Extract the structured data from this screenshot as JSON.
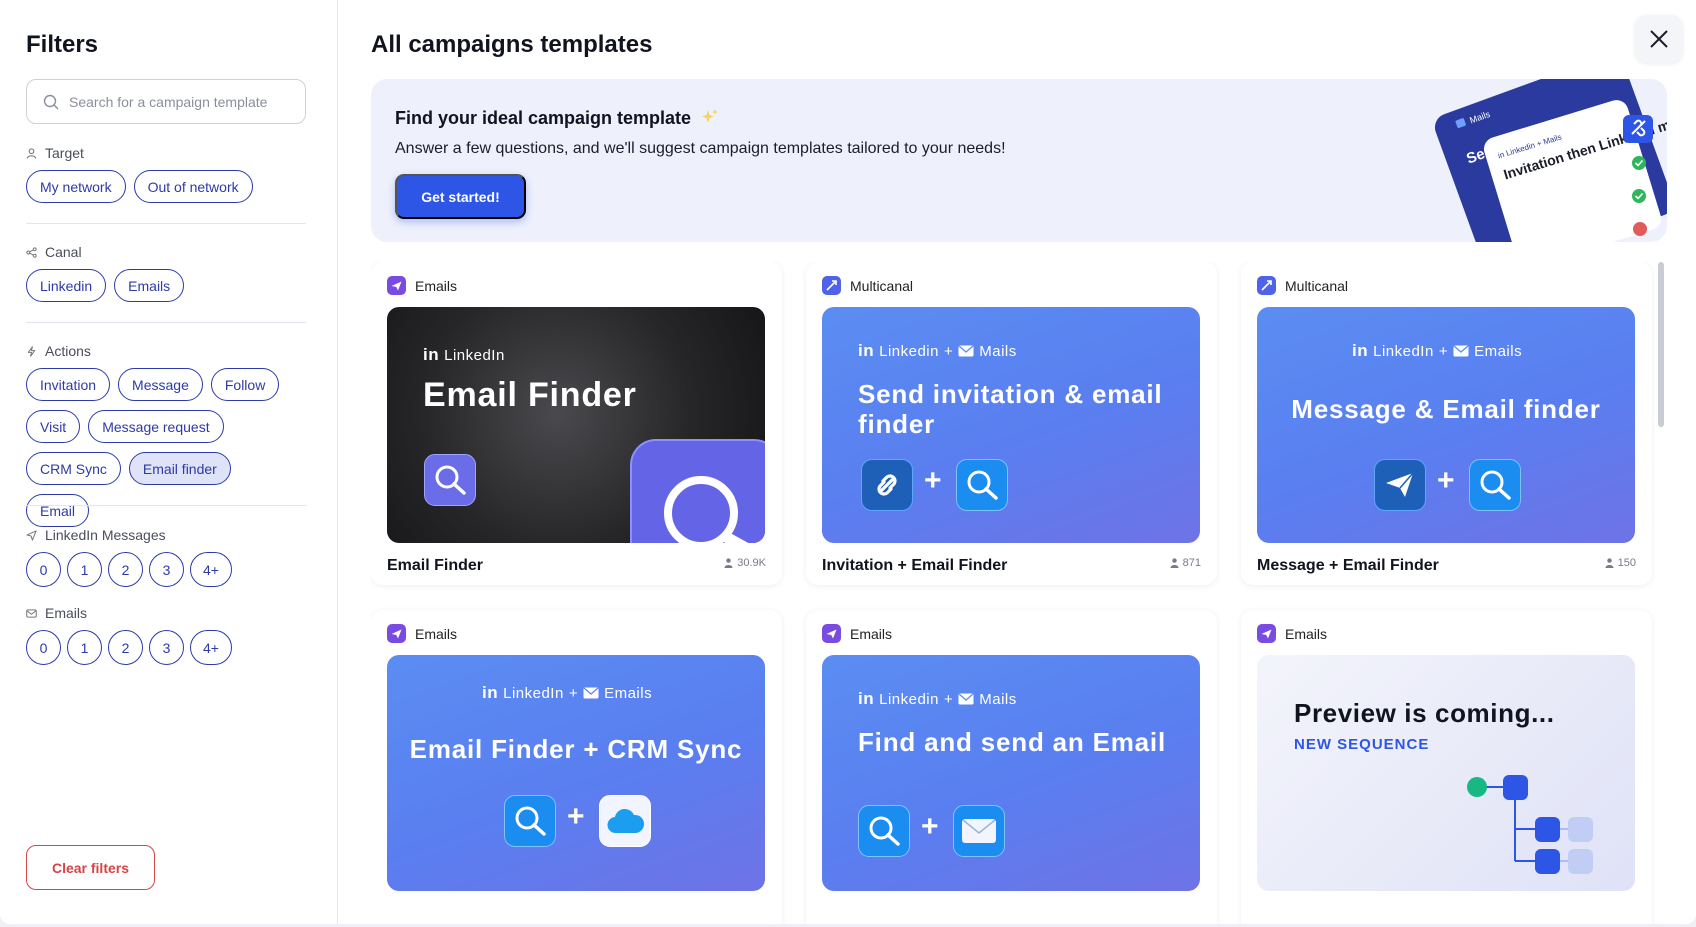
{
  "filters": {
    "title": "Filters",
    "search_placeholder": "Search for a campaign template",
    "target": {
      "label": "Target",
      "options": [
        "My network",
        "Out of network"
      ]
    },
    "canal": {
      "label": "Canal",
      "options": [
        "Linkedin",
        "Emails"
      ]
    },
    "actions": {
      "label": "Actions",
      "options": [
        "Invitation",
        "Message",
        "Follow",
        "Visit",
        "Message request",
        "CRM Sync",
        "Email finder",
        "Email"
      ],
      "selected": "Email finder"
    },
    "linkedin_messages": {
      "label": "LinkedIn Messages",
      "options": [
        "0",
        "1",
        "2",
        "3",
        "4+"
      ]
    },
    "emails": {
      "label": "Emails",
      "options": [
        "0",
        "1",
        "2",
        "3",
        "4+"
      ]
    },
    "clear_label": "Clear filters"
  },
  "main": {
    "title": "All campaigns templates",
    "banner": {
      "title": "Find your ideal campaign template",
      "subtitle": "Answer a few questions, and we'll suggest campaign templates tailored to your needs!",
      "button": "Get started!",
      "art": {
        "tag": "Mails",
        "front_header": "in Linkedin + Mails",
        "front_text": "Invitation then Linkedin messages or emails",
        "back_text": "Se... en..."
      }
    },
    "cards": [
      {
        "category": "Emails",
        "name": "Email Finder",
        "count": "30.9K",
        "thumb": {
          "top": "LinkedIn",
          "title": "Email Finder"
        }
      },
      {
        "category": "Multicanal",
        "name": "Invitation + Email Finder",
        "count": "871",
        "thumb": {
          "top_a": "Linkedin",
          "top_sep": "+",
          "top_b": "Mails",
          "title": "Send invitation & email finder"
        }
      },
      {
        "category": "Multicanal",
        "name": "Message + Email Finder",
        "count": "150",
        "thumb": {
          "top_a": "LinkedIn",
          "top_sep": "+",
          "top_b": "Emails",
          "title": "Message & Email finder"
        }
      },
      {
        "category": "Emails",
        "name": "",
        "thumb": {
          "top_a": "LinkedIn",
          "top_sep": "+",
          "top_b": "Emails",
          "title": "Email Finder + CRM Sync"
        }
      },
      {
        "category": "Emails",
        "name": "",
        "thumb": {
          "top_a": "Linkedin",
          "top_sep": "+",
          "top_b": "Mails",
          "title": "Find and send an Email"
        }
      },
      {
        "category": "Emails",
        "name": "",
        "thumb": {
          "title": "Preview is coming...",
          "subtitle": "NEW SEQUENCE"
        }
      }
    ]
  },
  "colors": {
    "primary": "#2d55e6",
    "chip": "#2d3aa8",
    "danger": "#d64545",
    "thumb_blue": "#5b8df2"
  }
}
